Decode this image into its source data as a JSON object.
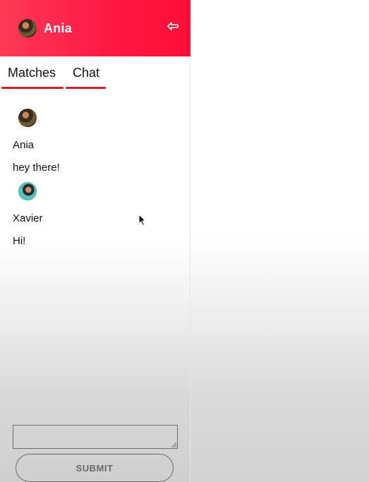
{
  "header": {
    "user_name": "Ania",
    "logout_icon": "logout-arrow-icon"
  },
  "tabs": [
    {
      "label": "Matches"
    },
    {
      "label": "Chat"
    }
  ],
  "messages": [
    {
      "name": "Ania",
      "text": "hey there!",
      "avatar": "avatar-ania"
    },
    {
      "name": "Xavier",
      "text": "Hi!",
      "avatar": "avatar-xavier"
    }
  ],
  "composer": {
    "value": "",
    "placeholder": ""
  },
  "submit": {
    "label": "SUBMIT"
  },
  "colors": {
    "header_start": "#fe3a56",
    "header_end": "#ff0f36",
    "tab_underline": "#d3202f"
  }
}
